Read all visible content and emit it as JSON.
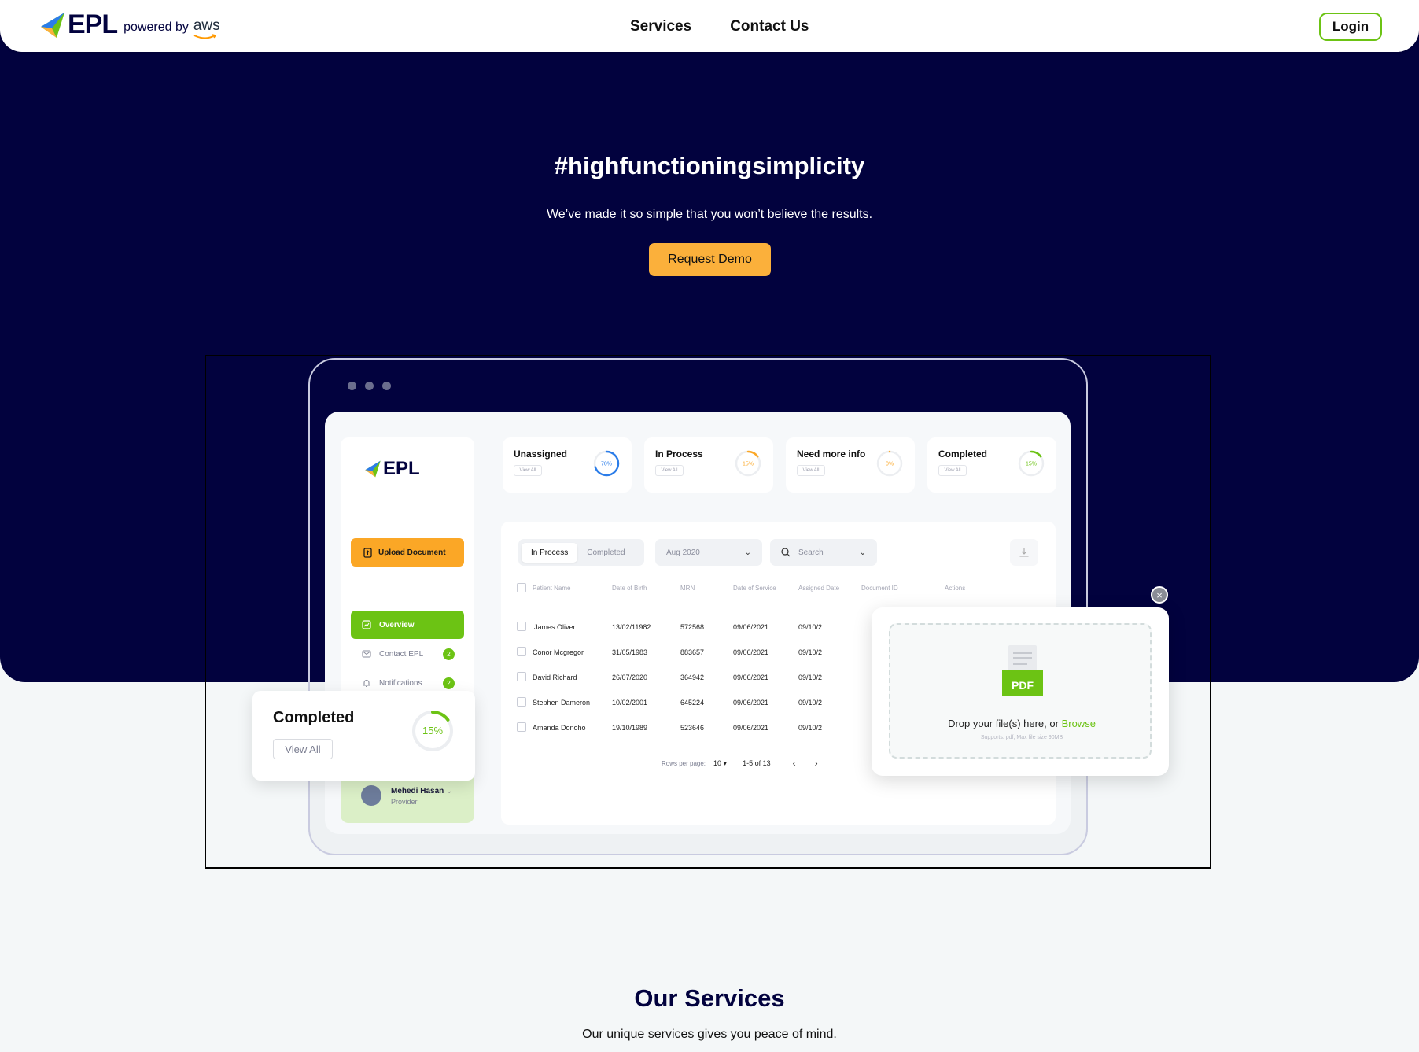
{
  "brand": {
    "name": "EPL",
    "powered_by": "powered by",
    "partner": "aws"
  },
  "nav": {
    "links": [
      "Services",
      "Contact Us"
    ],
    "login_label": "Login"
  },
  "hero": {
    "title": "#highfunctioningsimplicity",
    "subtitle": "We’ve made it so simple that you won’t believe the results.",
    "cta_label": "Request Demo"
  },
  "colors": {
    "navy": "#02023e",
    "accent_green": "#6cc314",
    "accent_orange": "#fbb03b",
    "ring_blue": "#2b7de9"
  },
  "dashboard": {
    "logo_text": "EPL",
    "upload_label": "Upload Document",
    "sidebar": [
      {
        "label": "Overview",
        "icon": "chart-icon",
        "badge": ""
      },
      {
        "label": "Contact EPL",
        "icon": "mail-icon",
        "badge": "2"
      },
      {
        "label": "Notifications",
        "icon": "bell-icon",
        "badge": "2"
      }
    ],
    "user": {
      "name": "Mehedi Hasan",
      "role": "Provider"
    },
    "stats": [
      {
        "label": "Unassigned",
        "view": "View All",
        "percent": "70%",
        "value": 0.7,
        "color": "#2b7de9"
      },
      {
        "label": "In Process",
        "view": "View All",
        "percent": "15%",
        "value": 0.15,
        "color": "#fba726"
      },
      {
        "label": "Need more info",
        "view": "View All",
        "percent": "0%",
        "value": 0.0,
        "color": "#fba726"
      },
      {
        "label": "Completed",
        "view": "View All",
        "percent": "15%",
        "value": 0.15,
        "color": "#6cc314"
      }
    ],
    "tabs": {
      "active": "In Process",
      "inactive": "Completed"
    },
    "date_filter": "Aug 2020",
    "search_placeholder": "Search",
    "columns": [
      "Patient Name",
      "Date of Birth",
      "MRN",
      "Date of Service",
      "Assigned Date",
      "Document ID",
      "Actions"
    ],
    "rows": [
      {
        "name": "James Oliver",
        "dob": "13/02/11982",
        "mrn": "572568",
        "dos": "09/06/2021",
        "assigned": "09/10/2"
      },
      {
        "name": "Conor Mcgregor",
        "dob": "31/05/1983",
        "mrn": "883657",
        "dos": "09/06/2021",
        "assigned": "09/10/2"
      },
      {
        "name": "David  Richard",
        "dob": "26/07/2020",
        "mrn": "364942",
        "dos": "09/06/2021",
        "assigned": "09/10/2"
      },
      {
        "name": "Stephen Dameron",
        "dob": "10/02/2001",
        "mrn": "645224",
        "dos": "09/06/2021",
        "assigned": "09/10/2"
      },
      {
        "name": "Amanda Donoho",
        "dob": "19/10/1989",
        "mrn": "523646",
        "dos": "09/06/2021",
        "assigned": "09/10/2"
      }
    ],
    "pager": {
      "rows_label": "Rows per page:",
      "rows_value": "10",
      "range": "1-5 of 13"
    }
  },
  "completed_card": {
    "title": "Completed",
    "view": "View All",
    "percent": "15%",
    "value": 0.15
  },
  "upload_card": {
    "icon_label": "PDF",
    "drop_text": "Drop your file(s) here, or",
    "browse": "Browse",
    "supports": "Supports: pdf, Max file size 90MB"
  },
  "services": {
    "title": "Our Services",
    "subtitle": "Our unique services gives you peace of mind."
  }
}
